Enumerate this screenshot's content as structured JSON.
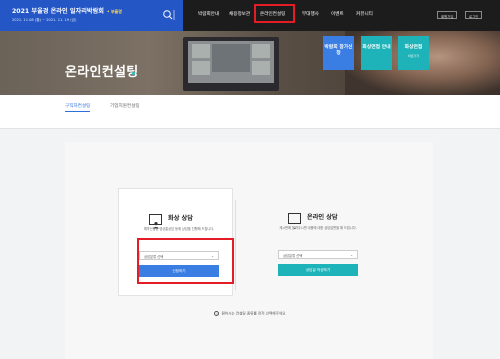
{
  "header": {
    "title": "2021 부울경 온라인 일자리박람회",
    "badge": "• 부울경",
    "date_range": "2021. 11.08 (월) ~ 2021. 11. 19 (금)",
    "nav_items": [
      "박람회안내",
      "채용정보관",
      "온라인컨설팅",
      "부대행사",
      "이벤트",
      "커뮤니티"
    ],
    "highlighted_nav_index": 2,
    "util_buttons": [
      "회원가입",
      "로그인"
    ]
  },
  "hero": {
    "title": "온라인컨설팅",
    "quick_buttons": [
      {
        "label": "박람회 참가신청",
        "sub": "",
        "color": "#3a7de3"
      },
      {
        "label": "화상면접 안내",
        "sub": "",
        "color": "#1db3b8"
      },
      {
        "label": "화상면접",
        "sub": "바로가기",
        "color": "#1db3b8"
      }
    ]
  },
  "tabs": {
    "items": [
      "구직자컨설팅",
      "기업지원컨설팅"
    ],
    "active_index": 0
  },
  "cards": {
    "video": {
      "title": "화상 상담",
      "description": "예약신청된 영상통상담 등에 상담을 진행해 드립니다.",
      "select_placeholder": "상담분류 선택",
      "button_label": "신청하기",
      "button_color": "#3a7de3"
    },
    "online": {
      "title": "온라인 상담",
      "description": "게시판에 올려주시면 내용에 대한 상담답변을 해 드립니다.",
      "select_placeholder": "상담분류 선택",
      "button_label": "상담글 작성하기",
      "button_color": "#1db3b8"
    }
  },
  "notice": "원하시는 컨설팅 종류를 먼저 선택해주세요",
  "colors": {
    "brand": "#2457c5",
    "header_bg": "#1c1c1c",
    "highlight": "#e31c25",
    "accent": "#2f6fdc"
  }
}
